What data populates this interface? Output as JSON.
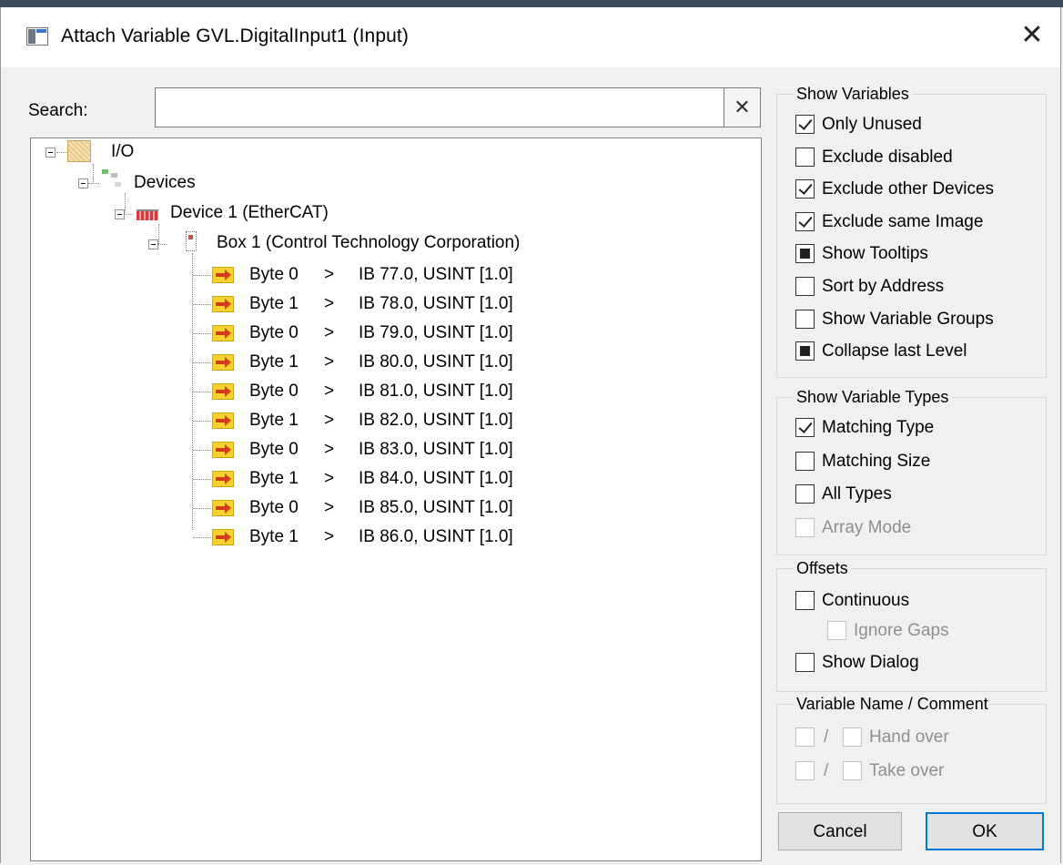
{
  "window": {
    "title": "Attach Variable GVL.DigitalInput1 (Input)",
    "close_glyph": "✕"
  },
  "search": {
    "label": "Search:",
    "value": "",
    "clear_glyph": "✕"
  },
  "tree": {
    "root": "I/O",
    "devices": "Devices",
    "device": "Device 1 (EtherCAT)",
    "box": "Box 1 (Control Technology Corporation)",
    "items": [
      {
        "name": "Byte 0",
        "arrow": ">",
        "address": "IB 77.0, USINT [1.0]"
      },
      {
        "name": "Byte 1",
        "arrow": ">",
        "address": "IB 78.0, USINT [1.0]"
      },
      {
        "name": "Byte 0",
        "arrow": ">",
        "address": "IB 79.0, USINT [1.0]"
      },
      {
        "name": "Byte 1",
        "arrow": ">",
        "address": "IB 80.0, USINT [1.0]"
      },
      {
        "name": "Byte 0",
        "arrow": ">",
        "address": "IB 81.0, USINT [1.0]"
      },
      {
        "name": "Byte 1",
        "arrow": ">",
        "address": "IB 82.0, USINT [1.0]"
      },
      {
        "name": "Byte 0",
        "arrow": ">",
        "address": "IB 83.0, USINT [1.0]"
      },
      {
        "name": "Byte 1",
        "arrow": ">",
        "address": "IB 84.0, USINT [1.0]"
      },
      {
        "name": "Byte 0",
        "arrow": ">",
        "address": "IB 85.0, USINT [1.0]"
      },
      {
        "name": "Byte 1",
        "arrow": ">",
        "address": "IB 86.0, USINT [1.0]"
      }
    ]
  },
  "show_variables": {
    "title": "Show Variables",
    "options": [
      {
        "label": "Only Unused",
        "state": "checked"
      },
      {
        "label": "Exclude disabled",
        "state": "unchecked"
      },
      {
        "label": "Exclude other Devices",
        "state": "checked"
      },
      {
        "label": "Exclude same Image",
        "state": "checked"
      },
      {
        "label": "Show Tooltips",
        "state": "indeterminate"
      },
      {
        "label": "Sort by Address",
        "state": "unchecked"
      },
      {
        "label": "Show Variable Groups",
        "state": "unchecked"
      },
      {
        "label": "Collapse last Level",
        "state": "indeterminate"
      }
    ]
  },
  "show_variable_types": {
    "title": "Show Variable Types",
    "options": [
      {
        "label": "Matching Type",
        "state": "checked"
      },
      {
        "label": "Matching Size",
        "state": "unchecked"
      },
      {
        "label": "All Types",
        "state": "unchecked"
      },
      {
        "label": "Array Mode",
        "state": "disabled"
      }
    ]
  },
  "offsets": {
    "title": "Offsets",
    "continuous": "Continuous",
    "ignore_gaps": "Ignore Gaps",
    "show_dialog": "Show Dialog"
  },
  "variable_name_comment": {
    "title": "Variable Name / Comment",
    "hand_over": "Hand over",
    "take_over": "Take over",
    "separator": "/"
  },
  "buttons": {
    "cancel": "Cancel",
    "ok": "OK"
  }
}
